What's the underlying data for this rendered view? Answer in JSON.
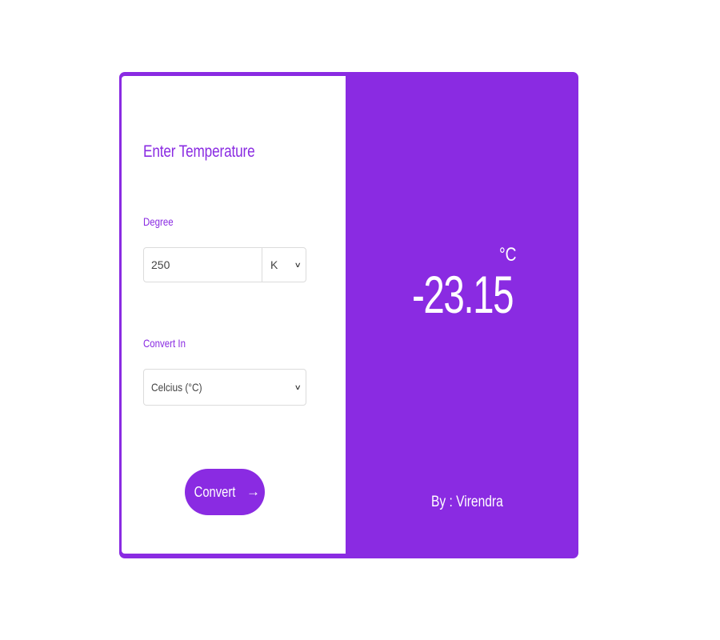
{
  "colors": {
    "accent": "#8a2be2",
    "panel_bg": "#ffffff",
    "text_on_accent": "#ffffff"
  },
  "form": {
    "heading": "Enter Temperature",
    "degree_label": "Degree",
    "degree_value": "250",
    "degree_unit": "K",
    "convert_label": "Convert In",
    "convert_selected": "Celcius (°C)",
    "convert_button_label": "Convert",
    "convert_button_icon": "arrow-right-icon"
  },
  "result": {
    "value": "-23.15",
    "unit": "°C",
    "author": "By : Virendra"
  }
}
